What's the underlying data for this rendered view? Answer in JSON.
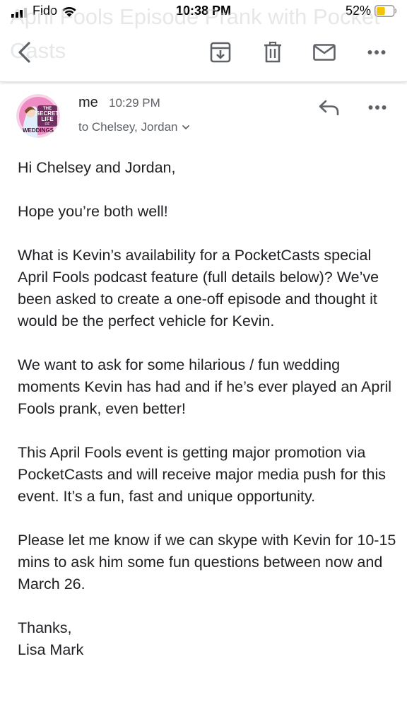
{
  "status_bar": {
    "carrier": "Fido",
    "time": "10:38 PM",
    "battery": "52%",
    "battery_level": 0.52
  },
  "subject_ghost": "April Fools Episode Prank with Pocket Casts",
  "toolbar": {
    "back_icon": "chevron-left-icon",
    "archive_icon": "archive-icon",
    "delete_icon": "trash-icon",
    "mark_icon": "mail-icon",
    "more_icon": "more-horizontal-icon"
  },
  "message": {
    "sender": "me",
    "time": "10:29 PM",
    "recipients": "to Chelsey, Jordan",
    "avatar_text": [
      "THE",
      "SECRET",
      "LIFE",
      "OF",
      "WEDDINGS"
    ],
    "body": [
      "Hi Chelsey and Jordan,",
      "Hope you’re both well!",
      "What is Kevin’s availability for a PocketCasts special April Fools podcast feature (full details below)? We’ve been asked to create a one-off episode and thought it would be the perfect vehicle for Kevin.",
      "We want to ask for some hilarious / fun wedding moments Kevin has had and if he’s ever played an April Fools prank, even better!",
      "This April Fools event is getting major promotion via PocketCasts and will receive major media push for this event. It’s a fun, fast and unique opportunity.",
      "Please let me know if we can skype with Kevin for 10-15 mins to ask him some fun questions between now and March 26.",
      "Thanks,",
      "Lisa Mark"
    ]
  },
  "colors": {
    "icon": "#5f6368",
    "text": "#202124",
    "battery_fill": "#f5c400"
  }
}
